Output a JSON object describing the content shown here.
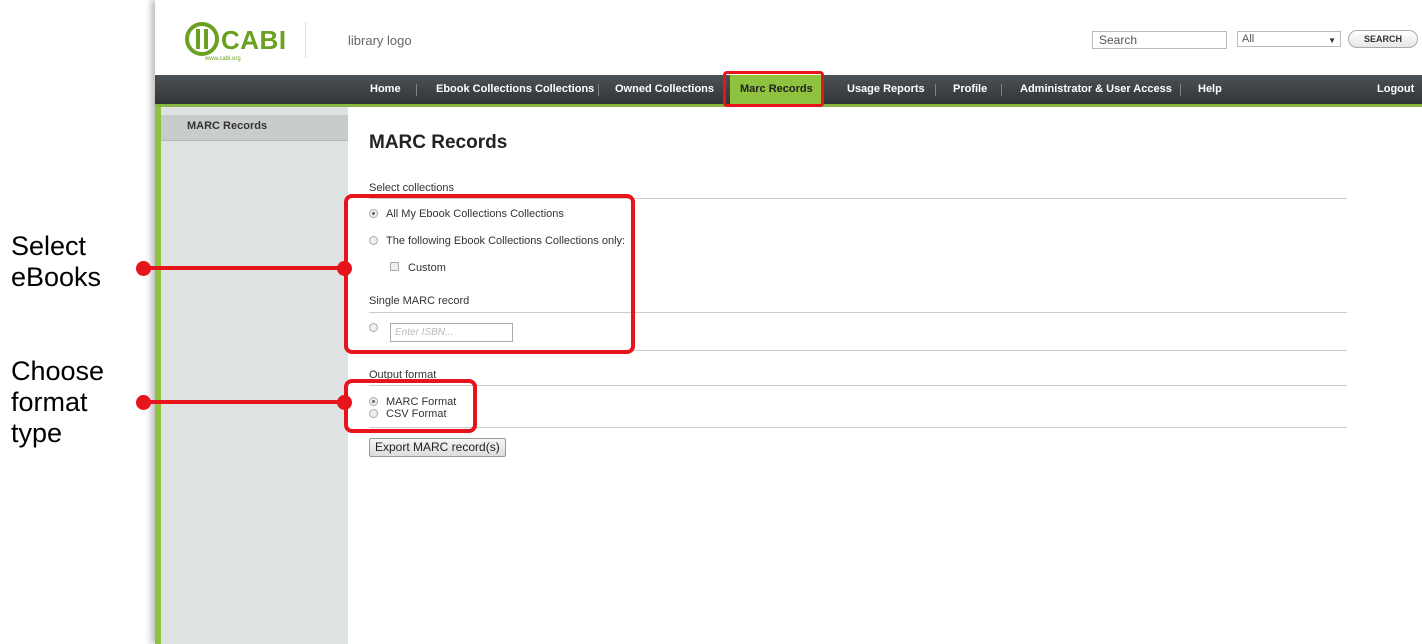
{
  "annotations": {
    "select": {
      "line1": "Select",
      "line2": "eBooks"
    },
    "format": {
      "line1": "Choose",
      "line2": "format",
      "line3": "type"
    },
    "highlight_color": "#e8141b"
  },
  "header": {
    "logo_text": "CABI",
    "logo_subtext": "www.cabi.org",
    "library_logo": "library logo",
    "search_placeholder": "Search",
    "search_scope": "All",
    "search_button": "SEARCH"
  },
  "nav": {
    "items": [
      {
        "label": "Home"
      },
      {
        "label": "Ebook Collections Collections"
      },
      {
        "label": "Owned Collections"
      },
      {
        "label": "Marc Records",
        "active": true
      },
      {
        "label": "Usage Reports"
      },
      {
        "label": "Profile"
      },
      {
        "label": "Administrator & User Access"
      },
      {
        "label": "Help"
      }
    ],
    "logout": "Logout",
    "accent_color": "#8fc23e"
  },
  "sidebar": {
    "items": [
      {
        "label": "MARC Records"
      }
    ]
  },
  "main": {
    "title": "MARC Records",
    "select_collections": {
      "label": "Select collections",
      "options": [
        {
          "label": "All My Ebook Collections Collections",
          "checked": true
        },
        {
          "label": "The following Ebook Collections Collections only:",
          "checked": false
        }
      ],
      "custom_label": "Custom"
    },
    "single_record": {
      "label": "Single MARC record",
      "isbn_placeholder": "Enter ISBN..."
    },
    "output_format": {
      "label": "Output format",
      "options": [
        {
          "label": "MARC Format",
          "checked": true
        },
        {
          "label": "CSV Format",
          "checked": false
        }
      ]
    },
    "export_button": "Export MARC record(s)"
  }
}
